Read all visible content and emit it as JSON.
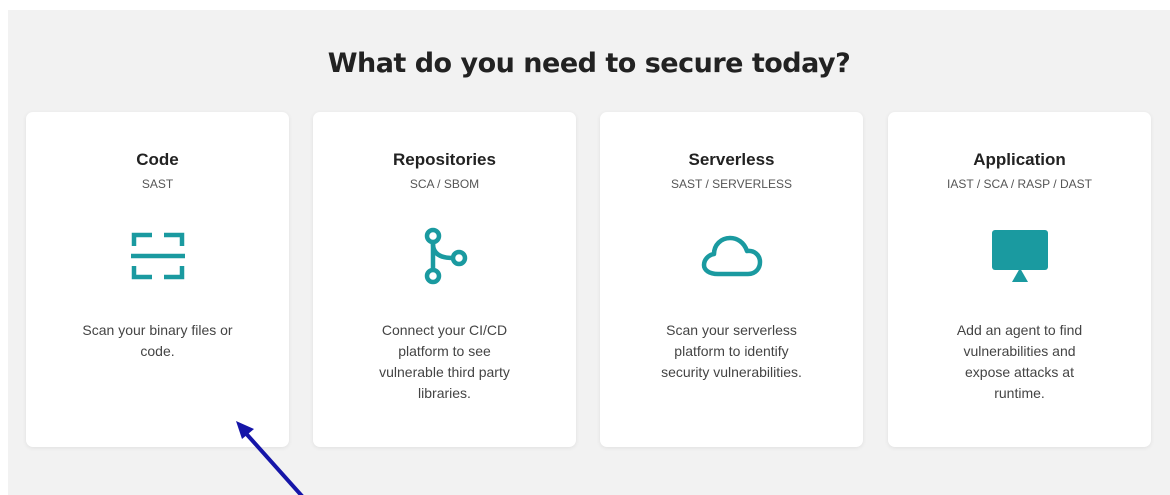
{
  "page": {
    "heading": "What do you need to secure today?"
  },
  "colors": {
    "accent": "#1a9aa0",
    "arrow": "#1515a8",
    "background": "#f2f2f2",
    "card": "#ffffff"
  },
  "cards": [
    {
      "title": "Code",
      "subtitle": "SAST",
      "icon": "scan-frame-icon",
      "description": "Scan your binary files or code."
    },
    {
      "title": "Repositories",
      "subtitle": "SCA / SBOM",
      "icon": "git-branch-icon",
      "description": "Connect your CI/CD platform to see vulnerable third party libraries."
    },
    {
      "title": "Serverless",
      "subtitle": "SAST / SERVERLESS",
      "icon": "cloud-icon",
      "description": "Scan your serverless platform to identify security vulnerabilities."
    },
    {
      "title": "Application",
      "subtitle": "IAST / SCA / RASP / DAST",
      "icon": "monitor-icon",
      "description": "Add an agent to find vulnerabilities and expose attacks at runtime."
    }
  ]
}
